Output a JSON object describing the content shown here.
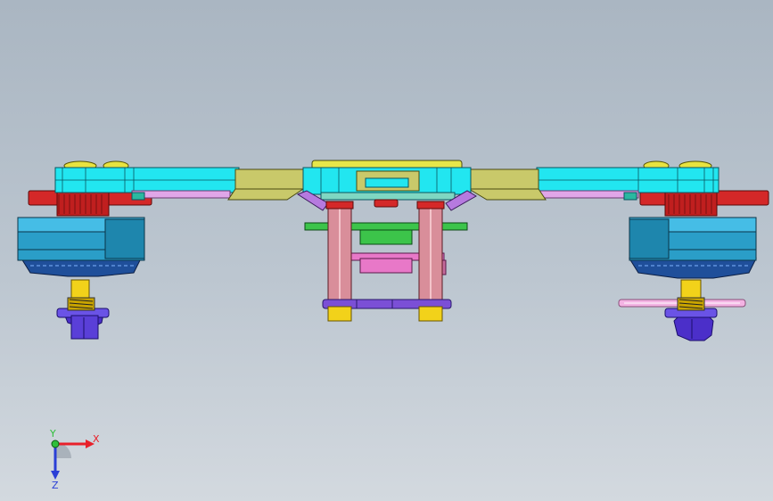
{
  "viewport": {
    "background_top": "#aab6c2",
    "background_bottom": "#d3d9df"
  },
  "triad": {
    "x_label": "X",
    "y_label": "Y",
    "z_label": "Z",
    "x_color": "#e8202a",
    "y_color": "#2fbf3a",
    "z_color": "#2a3fd6"
  },
  "parts": {
    "arm_color": "#22e6f0",
    "frame_color": "#c9c96a",
    "motor_color": "#2a9ec8",
    "bell_color": "#d42828",
    "standoff_color": "#d98e9a",
    "nut_color": "#5a3fd8",
    "shaft_color": "#f2d21a",
    "pcb_color": "#3cc44a",
    "board_color": "#e878c8",
    "mount_color": "#b67adf",
    "icons": [
      "drone-frame-model",
      "coordinate-triad-icon"
    ]
  }
}
